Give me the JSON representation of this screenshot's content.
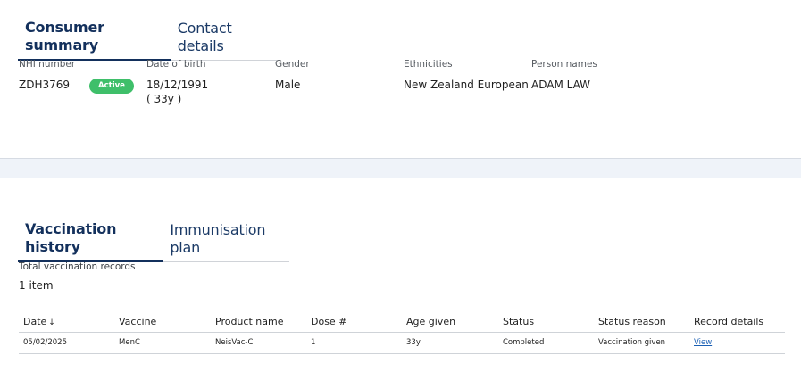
{
  "summary_tabs": [
    {
      "label": "Consumer summary",
      "active": true
    },
    {
      "label": "Contact details",
      "active": false
    }
  ],
  "consumer": {
    "nhi_label": "NHI number",
    "nhi_value": "ZDH3769",
    "status_badge": "Active",
    "dob_label": "Date of birth",
    "dob_value": "18/12/1991",
    "age_value": "( 33y )",
    "gender_label": "Gender",
    "gender_value": "Male",
    "ethnicities_label": "Ethnicities",
    "ethnicities_value": "New Zealand European",
    "names_label": "Person names",
    "names_value": "ADAM LAW"
  },
  "history_tabs": [
    {
      "label": "Vaccination history",
      "active": true
    },
    {
      "label": "Immunisation plan",
      "active": false
    }
  ],
  "records": {
    "label": "Total vaccination records",
    "count": "1 item"
  },
  "table": {
    "columns": [
      "Date",
      "Vaccine",
      "Product name",
      "Dose #",
      "Age given",
      "Status",
      "Status reason",
      "Record details"
    ],
    "sort_indicator": "↓",
    "rows": [
      [
        "05/02/2025",
        "MenC",
        "NeisVac-C",
        "1",
        "33y",
        "Completed",
        "Vaccination given",
        "View"
      ]
    ]
  },
  "colors": {
    "tab_active": "#13305c",
    "badge_active": "#3fbf6a",
    "link": "#1a5fb4",
    "band": "#eff3f9"
  }
}
